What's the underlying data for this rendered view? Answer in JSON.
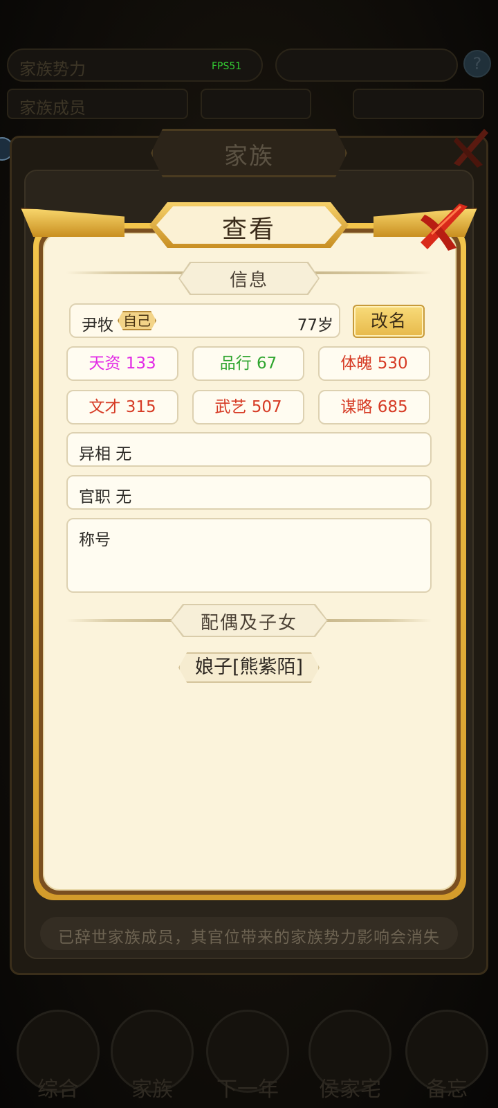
{
  "hud": {
    "fps": "FPS51",
    "top_left_label": "家族势力",
    "member_label": "家族成员",
    "help_symbol": "?"
  },
  "back_panel": {
    "title": "家族",
    "notice": "已辞世家族成员，其官位带来的家族势力影响会消失"
  },
  "bottom_nav": {
    "items": [
      {
        "label": "综合"
      },
      {
        "label": "家族"
      },
      {
        "label": "下一年"
      },
      {
        "label": "侯家宅"
      },
      {
        "label": "备忘"
      }
    ]
  },
  "dialog": {
    "title": "查看",
    "close_icon": "close-x-icon",
    "info_section": "信息",
    "member": {
      "name": "尹牧",
      "self_tag": "自己",
      "age": "77岁"
    },
    "rename_button": "改名",
    "stats": [
      {
        "text": "天资 133",
        "color": "#e229e6"
      },
      {
        "text": "品行 67",
        "color": "#2fa52f"
      },
      {
        "text": "体魄 530",
        "color": "#d63a24"
      },
      {
        "text": "文才 315",
        "color": "#d63a24"
      },
      {
        "text": "武艺 507",
        "color": "#d63a24"
      },
      {
        "text": "谋略 685",
        "color": "#d63a24"
      }
    ],
    "trait": "异相 无",
    "official_post": "官职 无",
    "title_field_label": "称号",
    "family_section": "配偶及子女",
    "spouse": "娘子[熊紫陌]"
  }
}
